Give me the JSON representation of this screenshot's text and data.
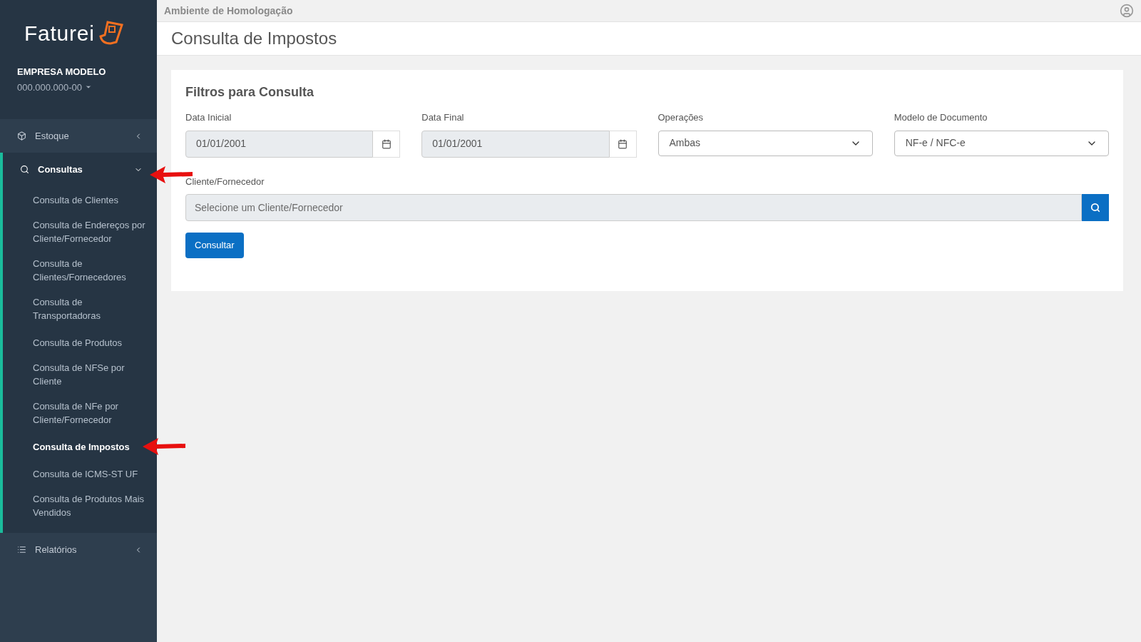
{
  "sidebar": {
    "logo_text": "Faturei",
    "company": {
      "name": "EMPRESA MODELO",
      "id": "000.000.000-00"
    },
    "menu": [
      {
        "label": "Estoque",
        "kind": "box",
        "expanded": false
      },
      {
        "label": "Consultas",
        "kind": "search",
        "expanded": true,
        "children": [
          {
            "label": "Consulta de Clientes",
            "selected": false
          },
          {
            "label": "Consulta de Endereços por Cliente/Fornecedor",
            "selected": false
          },
          {
            "label": "Consulta de Clientes/Fornecedores",
            "selected": false
          },
          {
            "label": "Consulta de Transportadoras",
            "selected": false
          },
          {
            "label": "Consulta de Produtos",
            "selected": false
          },
          {
            "label": "Consulta de NFSe por Cliente",
            "selected": false
          },
          {
            "label": "Consulta de NFe por Cliente/Fornecedor",
            "selected": false
          },
          {
            "label": "Consulta de Impostos",
            "selected": true
          },
          {
            "label": "Consulta de ICMS-ST UF",
            "selected": false
          },
          {
            "label": "Consulta de Produtos Mais Vendidos",
            "selected": false
          }
        ]
      },
      {
        "label": "Relatórios",
        "kind": "list",
        "expanded": false
      }
    ]
  },
  "top_bar": {
    "environment": "Ambiente de Homologação"
  },
  "page_title": "Consulta de Impostos",
  "filters": {
    "title": "Filtros para Consulta",
    "fields": [
      {
        "label": "Data Inicial",
        "kind": "date",
        "value": "01/01/2001"
      },
      {
        "label": "Data Final",
        "kind": "date",
        "value": "01/01/2001"
      },
      {
        "label": "Operações",
        "kind": "select",
        "value": "Ambas"
      },
      {
        "label": "Modelo de Documento",
        "kind": "select",
        "value": "NF-e / NFC-e"
      }
    ],
    "client": {
      "label": "Cliente/Fornecedor",
      "placeholder": "Selecione um Cliente/Fornecedor"
    },
    "submit": "Consultar"
  }
}
